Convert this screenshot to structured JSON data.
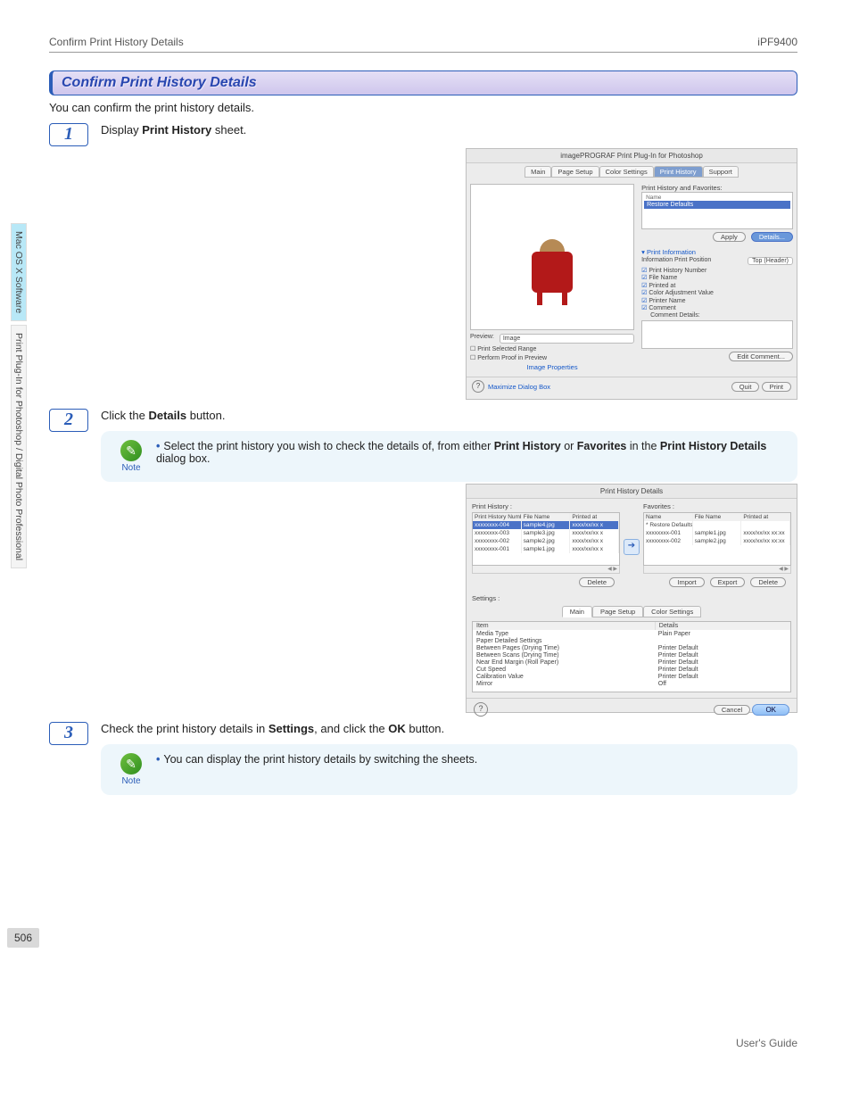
{
  "header": {
    "left": "Confirm Print History Details",
    "right": "iPF9400"
  },
  "sideTabs": {
    "t1": "Mac OS X Software",
    "t2": "Print Plug-In for Photoshop / Digital Photo Professional"
  },
  "title": "Confirm Print History Details",
  "intro": "You can confirm the print history details.",
  "steps": {
    "s1": {
      "num": "1",
      "pre": "Display ",
      "bold": "Print History",
      "post": " sheet."
    },
    "s2": {
      "num": "2",
      "pre": "Click the ",
      "bold": "Details",
      "post": " button."
    },
    "s3": {
      "num": "3",
      "pre": "Check the print history details in ",
      "b1": "Settings",
      "mid": ", and click the ",
      "b2": "OK",
      "post": " button."
    }
  },
  "notes": {
    "label": "Note",
    "n1a": "Select the print history you wish to check the details of, from either ",
    "n1b": "Print History",
    "n1c": " or ",
    "n1d": "Favorites",
    "n1e": " in the ",
    "n1f": "Print History Details",
    "n1g": " dialog box.",
    "n2": "You can display the print history details by switching the sheets."
  },
  "shot1": {
    "title": "imagePROGRAF Print Plug-In for Photoshop",
    "tabs": {
      "main": "Main",
      "page": "Page Setup",
      "color": "Color Settings",
      "hist": "Print History",
      "support": "Support"
    },
    "favTitle": "Print History and Favorites:",
    "nameCol": "Name",
    "restore": "Restore Defaults",
    "apply": "Apply",
    "details": "Details...",
    "infoTitle": "Print Information",
    "infoPos": "Information Print Position",
    "infoPosVal": "Top (Header)",
    "chk": {
      "num": "Print History Number",
      "file": "File Name",
      "printed": "Printed at",
      "cadj": "Color Adjustment Value",
      "pname": "Printer Name",
      "comment": "Comment"
    },
    "commentDetails": "Comment Details:",
    "editComment": "Edit Comment...",
    "previewLbl": "Preview:",
    "previewVal": "Image",
    "chkRange": "Print Selected Range",
    "chkProof": "Perform Proof in Preview",
    "imgProps": "Image Properties",
    "maximize": "Maximize Dialog Box",
    "quit": "Quit",
    "print": "Print"
  },
  "shot2": {
    "title": "Print History Details",
    "phLabel": "Print History :",
    "favLabel": "Favorites :",
    "cols": {
      "num": "Print History Number",
      "file": "File Name",
      "printed": "Printed at",
      "name": "Name"
    },
    "ph": [
      {
        "n": "xxxxxxxx-004",
        "f": "sample4.jpg",
        "p": "xxxx/xx/xx x"
      },
      {
        "n": "xxxxxxxx-003",
        "f": "sample3.jpg",
        "p": "xxxx/xx/xx x"
      },
      {
        "n": "xxxxxxxx-002",
        "f": "sample2.jpg",
        "p": "xxxx/xx/xx x"
      },
      {
        "n": "xxxxxxxx-001",
        "f": "sample1.jpg",
        "p": "xxxx/xx/xx x"
      }
    ],
    "fav": [
      {
        "n": "* Restore Defaults",
        "f": "",
        "p": ""
      },
      {
        "n": "xxxxxxxx-001",
        "f": "sample1.jpg",
        "p": "xxxx/xx/xx xx:xx"
      },
      {
        "n": "xxxxxxxx-002",
        "f": "sample2.jpg",
        "p": "xxxx/xx/xx xx:xx"
      }
    ],
    "btns": {
      "delete": "Delete",
      "import": "Import",
      "export": "Export"
    },
    "settingsLabel": "Settings :",
    "tabs2": {
      "main": "Main",
      "page": "Page Setup",
      "color": "Color Settings"
    },
    "dcols": {
      "item": "Item",
      "details": "Details"
    },
    "drows": [
      {
        "i": "Media Type",
        "d": "Plain Paper"
      },
      {
        "i": "Paper Detailed Settings",
        "d": ""
      },
      {
        "i": "  Between Pages (Drying Time)",
        "d": "Printer Default"
      },
      {
        "i": "  Between Scans (Drying Time)",
        "d": "Printer Default"
      },
      {
        "i": "  Near End Margin (Roll Paper)",
        "d": "Printer Default"
      },
      {
        "i": "  Cut Speed",
        "d": "Printer Default"
      },
      {
        "i": "  Calibration Value",
        "d": "Printer Default"
      },
      {
        "i": "  Mirror",
        "d": "Off"
      }
    ],
    "cancel": "Cancel",
    "ok": "OK"
  },
  "pageNum": "506",
  "guide": "User's Guide"
}
